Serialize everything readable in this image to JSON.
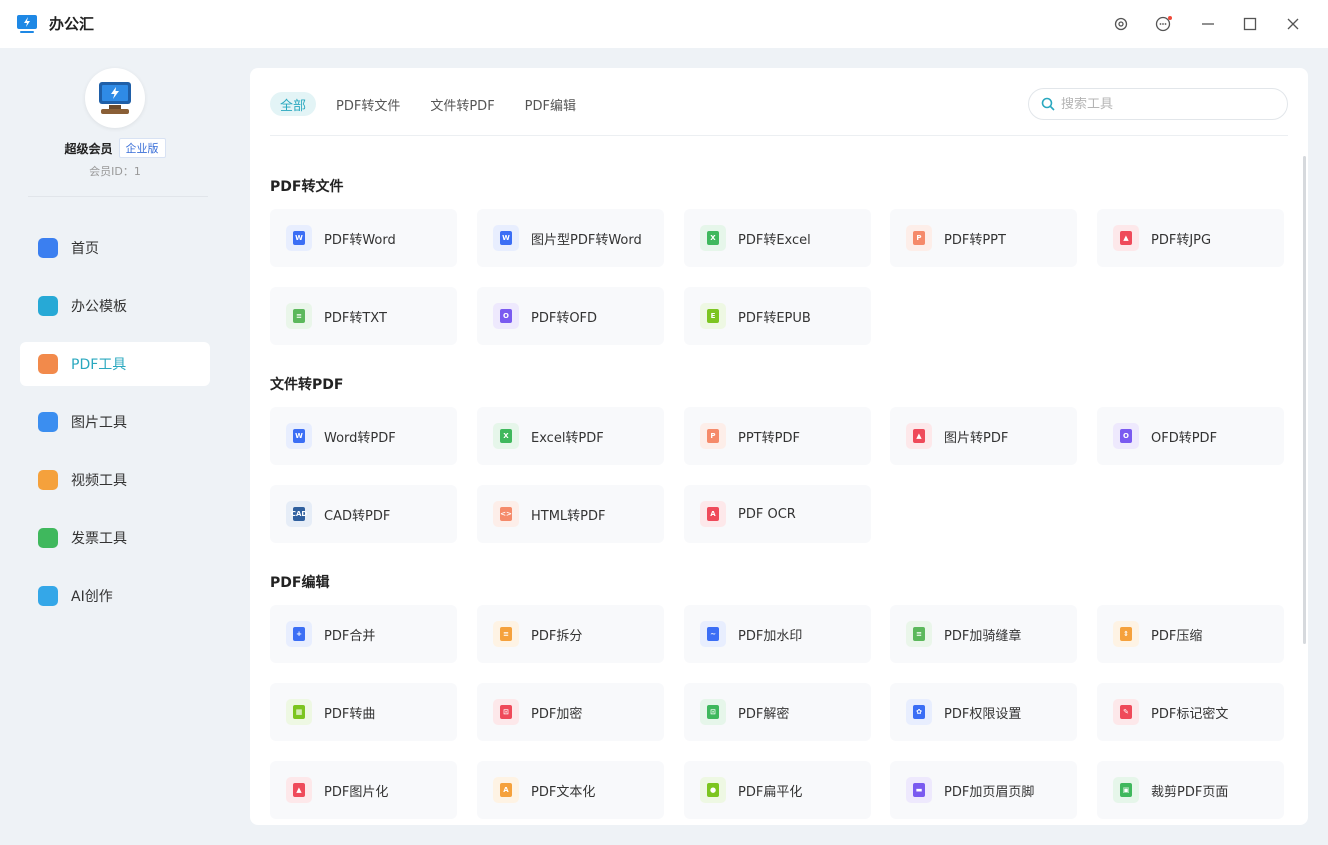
{
  "app": {
    "title": "办公汇",
    "logo_color": "#1e88e5"
  },
  "window_controls": [
    {
      "name": "settings-icon"
    },
    {
      "name": "message-icon"
    },
    {
      "name": "minimize-icon"
    },
    {
      "name": "maximize-icon"
    },
    {
      "name": "close-icon"
    }
  ],
  "user": {
    "name": "超级会员",
    "badge": "企业版",
    "member_id": "会员ID：1"
  },
  "nav": [
    {
      "label": "首页",
      "icon": "home-icon",
      "color": "#3b7ff0",
      "active": false
    },
    {
      "label": "办公模板",
      "icon": "briefcase-icon",
      "color": "#27a9d6",
      "active": false
    },
    {
      "label": "PDF工具",
      "icon": "pdf-icon",
      "color": "#f28a4b",
      "active": true
    },
    {
      "label": "图片工具",
      "icon": "image-icon",
      "color": "#3b8ef0",
      "active": false
    },
    {
      "label": "视频工具",
      "icon": "video-icon",
      "color": "#f5a13c",
      "active": false
    },
    {
      "label": "发票工具",
      "icon": "invoice-icon",
      "color": "#3fb85d",
      "active": false
    },
    {
      "label": "AI创作",
      "icon": "ai-icon",
      "color": "#34a7e8",
      "active": false
    }
  ],
  "tabs": [
    {
      "label": "全部",
      "active": true
    },
    {
      "label": "PDF转文件",
      "active": false
    },
    {
      "label": "文件转PDF",
      "active": false
    },
    {
      "label": "PDF编辑",
      "active": false
    }
  ],
  "search": {
    "placeholder": "搜索工具",
    "value": ""
  },
  "sections": [
    {
      "title": "PDF转文件",
      "tools": [
        {
          "label": "PDF转Word",
          "icon": "word-icon",
          "glyph": "W",
          "color": "#3b6ef5",
          "bg": "#e8eefe"
        },
        {
          "label": "图片型PDF转Word",
          "icon": "word-icon",
          "glyph": "W",
          "color": "#3b6ef5",
          "bg": "#e8eefe"
        },
        {
          "label": "PDF转Excel",
          "icon": "excel-icon",
          "glyph": "X",
          "color": "#3fb85d",
          "bg": "#e6f6ea"
        },
        {
          "label": "PDF转PPT",
          "icon": "ppt-icon",
          "glyph": "P",
          "color": "#f58a6a",
          "bg": "#fdeee9"
        },
        {
          "label": "PDF转JPG",
          "icon": "jpg-icon",
          "glyph": "▲",
          "color": "#ef4a5a",
          "bg": "#fde8ea"
        },
        {
          "label": "PDF转TXT",
          "icon": "txt-icon",
          "glyph": "≡",
          "color": "#5cb85c",
          "bg": "#eaf6ea"
        },
        {
          "label": "PDF转OFD",
          "icon": "ofd-icon",
          "glyph": "O",
          "color": "#7a5af0",
          "bg": "#eee9fd"
        },
        {
          "label": "PDF转EPUB",
          "icon": "epub-icon",
          "glyph": "E",
          "color": "#7cc520",
          "bg": "#eef8e3"
        }
      ]
    },
    {
      "title": "文件转PDF",
      "tools": [
        {
          "label": "Word转PDF",
          "icon": "word-icon",
          "glyph": "W",
          "color": "#3b6ef5",
          "bg": "#e8eefe"
        },
        {
          "label": "Excel转PDF",
          "icon": "excel-icon",
          "glyph": "X",
          "color": "#3fb85d",
          "bg": "#e6f6ea"
        },
        {
          "label": "PPT转PDF",
          "icon": "ppt-icon",
          "glyph": "P",
          "color": "#f58a6a",
          "bg": "#fdeee9"
        },
        {
          "label": "图片转PDF",
          "icon": "image-icon",
          "glyph": "▲",
          "color": "#ef4a5a",
          "bg": "#fde8ea"
        },
        {
          "label": "OFD转PDF",
          "icon": "ofd-icon",
          "glyph": "O",
          "color": "#7a5af0",
          "bg": "#eee9fd"
        },
        {
          "label": "CAD转PDF",
          "icon": "cad-icon",
          "glyph": "CAD",
          "color": "#2f5f9e",
          "bg": "#e6edf7"
        },
        {
          "label": "HTML转PDF",
          "icon": "html-icon",
          "glyph": "<>",
          "color": "#f58a6a",
          "bg": "#fdeee9"
        },
        {
          "label": "PDF OCR",
          "icon": "ocr-icon",
          "glyph": "A",
          "color": "#ef4a5a",
          "bg": "#fde8ea"
        }
      ]
    },
    {
      "title": "PDF编辑",
      "tools": [
        {
          "label": "PDF合并",
          "icon": "merge-icon",
          "glyph": "+",
          "color": "#3b6ef5",
          "bg": "#e8eefe"
        },
        {
          "label": "PDF拆分",
          "icon": "split-icon",
          "glyph": "≡",
          "color": "#f5a13c",
          "bg": "#fef3e4"
        },
        {
          "label": "PDF加水印",
          "icon": "watermark-icon",
          "glyph": "~",
          "color": "#3b6ef5",
          "bg": "#e8eefe"
        },
        {
          "label": "PDF加骑缝章",
          "icon": "seal-icon",
          "glyph": "≡",
          "color": "#5cb85c",
          "bg": "#eaf6ea"
        },
        {
          "label": "PDF压缩",
          "icon": "compress-icon",
          "glyph": "⇕",
          "color": "#f5a13c",
          "bg": "#fef3e4"
        },
        {
          "label": "PDF转曲",
          "icon": "curve-icon",
          "glyph": "▦",
          "color": "#7cc520",
          "bg": "#eef8e3"
        },
        {
          "label": "PDF加密",
          "icon": "lock-icon",
          "glyph": "⊡",
          "color": "#ef4a5a",
          "bg": "#fde8ea"
        },
        {
          "label": "PDF解密",
          "icon": "unlock-icon",
          "glyph": "⊡",
          "color": "#3fb85d",
          "bg": "#e6f6ea"
        },
        {
          "label": "PDF权限设置",
          "icon": "permission-icon",
          "glyph": "✿",
          "color": "#3b6ef5",
          "bg": "#e8eefe"
        },
        {
          "label": "PDF标记密文",
          "icon": "mark-icon",
          "glyph": "✎",
          "color": "#ef4a5a",
          "bg": "#fde8ea"
        },
        {
          "label": "PDF图片化",
          "icon": "image-icon",
          "glyph": "▲",
          "color": "#ef4a5a",
          "bg": "#fde8ea"
        },
        {
          "label": "PDF文本化",
          "icon": "text-icon",
          "glyph": "A",
          "color": "#f5a13c",
          "bg": "#fef3e4"
        },
        {
          "label": "PDF扁平化",
          "icon": "flatten-icon",
          "glyph": "●",
          "color": "#7cc520",
          "bg": "#eef8e3"
        },
        {
          "label": "PDF加页眉页脚",
          "icon": "header-footer-icon",
          "glyph": "▬",
          "color": "#7a5af0",
          "bg": "#eee9fd"
        },
        {
          "label": "裁剪PDF页面",
          "icon": "crop-icon",
          "glyph": "▣",
          "color": "#3fb85d",
          "bg": "#e6f6ea"
        }
      ]
    }
  ]
}
